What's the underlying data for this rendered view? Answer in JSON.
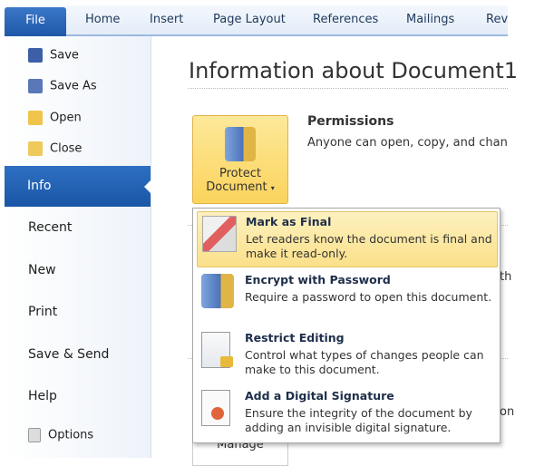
{
  "ribbon": {
    "tabs": [
      "File",
      "Home",
      "Insert",
      "Page Layout",
      "References",
      "Mailings",
      "Rev"
    ]
  },
  "sidebar": {
    "items": [
      "Save",
      "Save As",
      "Open",
      "Close",
      "Info",
      "Recent",
      "New",
      "Print",
      "Save & Send",
      "Help",
      "Options"
    ],
    "selected": "Info"
  },
  "main": {
    "title": "Information about Document1",
    "permissions_title": "Permissions",
    "permissions_text": "Anyone can open, copy, and chan",
    "protect_button": [
      "Protect",
      "Document"
    ],
    "partial_1": "th",
    "partial_2": "on",
    "manage": "Manage"
  },
  "menu": {
    "items": [
      {
        "title": "Mark as Final",
        "desc": "Let readers know the document is final and make it read-only.",
        "icon": "mark-final-icon"
      },
      {
        "title": "Encrypt with Password",
        "desc": "Require a password to open this document.",
        "icon": "lock-key-icon"
      },
      {
        "title": "Restrict Editing",
        "desc": "Control what types of changes people can make to this document.",
        "icon": "document-lock-icon"
      },
      {
        "title": "Add a Digital Signature",
        "desc": "Ensure the integrity of the document by adding an invisible digital signature.",
        "icon": "ribbon-seal-icon"
      }
    ]
  }
}
